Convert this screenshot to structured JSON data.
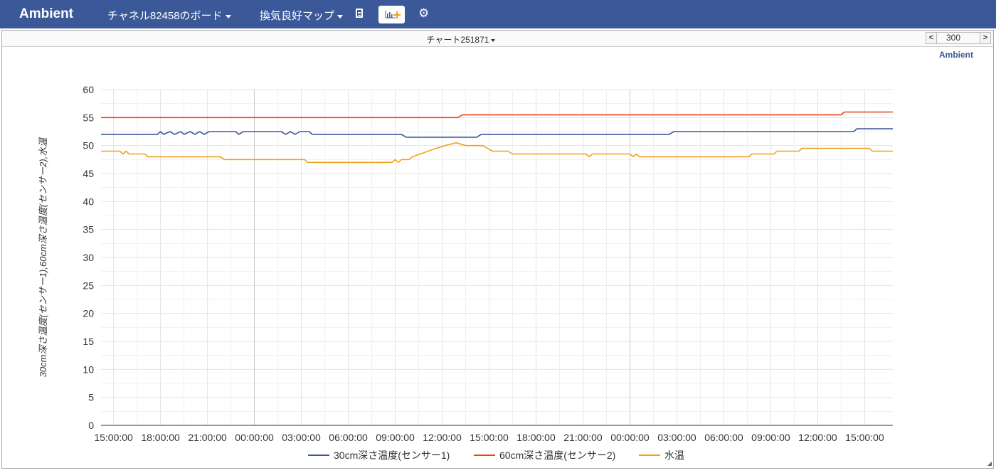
{
  "app": {
    "brand": "Ambient"
  },
  "nav": {
    "board_label": "チャネル82458のボード",
    "map_label": "換気良好マップ",
    "doc_icon": "document-icon",
    "add_chart_icon": "add-chart-icon",
    "settings_icon": "gear-icon"
  },
  "panel": {
    "chart_title": "チャート251871",
    "range_value": "300",
    "prev_label": "<",
    "next_label": ">",
    "watermark": "Ambient"
  },
  "chart_data": {
    "type": "line",
    "ylabel": "30cm深さ温度(センサー1),60cm深さ温度(センサー2),水温",
    "ylim": [
      0,
      60
    ],
    "yticks": [
      "0",
      "5",
      "10",
      "15",
      "20",
      "25",
      "30",
      "35",
      "40",
      "45",
      "50",
      "55",
      "60"
    ],
    "xticks": [
      "15:00:00",
      "18:00:00",
      "21:00:00",
      "00:00:00",
      "03:00:00",
      "06:00:00",
      "09:00:00",
      "12:00:00",
      "15:00:00",
      "18:00:00",
      "21:00:00",
      "00:00:00",
      "03:00:00",
      "06:00:00",
      "09:00:00",
      "12:00:00",
      "15:00:00"
    ],
    "x_hours": [
      0,
      3,
      6,
      9,
      12,
      15,
      18,
      21,
      24,
      27,
      30,
      33,
      36,
      39,
      42,
      45,
      48
    ],
    "x_range": [
      -0.8,
      49.8
    ],
    "grid": true,
    "legend": "bottom",
    "colors": {
      "s1": "#3b5998",
      "s2": "#e8431b",
      "s3": "#f0a11a",
      "grid": "#e4e4e4",
      "day_line": "#c8c8c8"
    },
    "series": [
      {
        "name": "30cm深さ温度(センサー1)",
        "color": "#3b5998",
        "points": [
          [
            -0.8,
            52
          ],
          [
            2.8,
            52
          ],
          [
            3.0,
            52.5
          ],
          [
            3.2,
            52
          ],
          [
            3.6,
            52.5
          ],
          [
            3.9,
            52
          ],
          [
            4.3,
            52.5
          ],
          [
            4.5,
            52
          ],
          [
            4.9,
            52.5
          ],
          [
            5.2,
            52
          ],
          [
            5.5,
            52.5
          ],
          [
            5.8,
            52
          ],
          [
            6.1,
            52.5
          ],
          [
            7.8,
            52.5
          ],
          [
            8.0,
            52
          ],
          [
            8.3,
            52.5
          ],
          [
            10.7,
            52.5
          ],
          [
            11.0,
            52
          ],
          [
            11.3,
            52.5
          ],
          [
            11.6,
            52
          ],
          [
            11.9,
            52.5
          ],
          [
            12.5,
            52.5
          ],
          [
            12.7,
            52
          ],
          [
            18.4,
            52
          ],
          [
            18.7,
            51.5
          ],
          [
            23.2,
            51.5
          ],
          [
            23.5,
            52
          ],
          [
            35.5,
            52
          ],
          [
            35.8,
            52.5
          ],
          [
            47.3,
            52.5
          ],
          [
            47.5,
            53
          ],
          [
            49.8,
            53
          ]
        ]
      },
      {
        "name": "60cm深さ温度(センサー2)",
        "color": "#e8431b",
        "points": [
          [
            -0.8,
            55
          ],
          [
            22.0,
            55
          ],
          [
            22.3,
            55.5
          ],
          [
            46.5,
            55.5
          ],
          [
            46.7,
            56
          ],
          [
            49.8,
            56
          ]
        ]
      },
      {
        "name": "水温",
        "color": "#f0a11a",
        "points": [
          [
            -0.8,
            49
          ],
          [
            0.4,
            49
          ],
          [
            0.6,
            48.5
          ],
          [
            0.8,
            49
          ],
          [
            1.0,
            48.5
          ],
          [
            2.0,
            48.5
          ],
          [
            2.2,
            48
          ],
          [
            6.8,
            48
          ],
          [
            7.1,
            47.5
          ],
          [
            12.2,
            47.5
          ],
          [
            12.4,
            47
          ],
          [
            17.8,
            47
          ],
          [
            18.0,
            47.5
          ],
          [
            18.2,
            47
          ],
          [
            18.4,
            47.5
          ],
          [
            18.9,
            47.5
          ],
          [
            19.1,
            48
          ],
          [
            19.6,
            48.5
          ],
          [
            20.1,
            49
          ],
          [
            20.6,
            49.5
          ],
          [
            21.2,
            50
          ],
          [
            21.9,
            50.5
          ],
          [
            22.5,
            50
          ],
          [
            23.6,
            50
          ],
          [
            23.9,
            49.5
          ],
          [
            24.2,
            49
          ],
          [
            25.2,
            49
          ],
          [
            25.5,
            48.5
          ],
          [
            30.2,
            48.5
          ],
          [
            30.4,
            48
          ],
          [
            30.6,
            48.5
          ],
          [
            33.0,
            48.5
          ],
          [
            33.2,
            48
          ],
          [
            33.4,
            48.5
          ],
          [
            33.6,
            48
          ],
          [
            40.6,
            48
          ],
          [
            40.8,
            48.5
          ],
          [
            42.2,
            48.5
          ],
          [
            42.4,
            49
          ],
          [
            43.8,
            49
          ],
          [
            44.0,
            49.5
          ],
          [
            48.3,
            49.5
          ],
          [
            48.5,
            49
          ],
          [
            49.8,
            49
          ]
        ]
      }
    ]
  }
}
